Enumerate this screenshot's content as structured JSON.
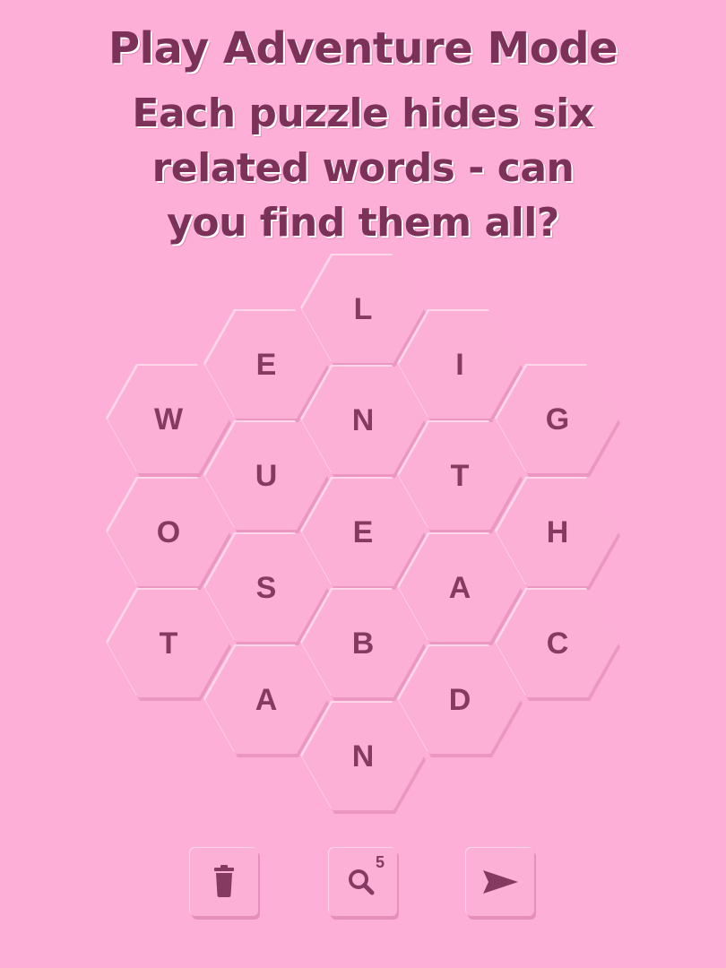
{
  "header": {
    "title": "Play Adventure Mode",
    "subtitle_lines": [
      "Each puzzle hides six",
      "related words - can",
      "you find them all?"
    ]
  },
  "board": {
    "tiles": [
      {
        "letter": "L"
      },
      {
        "letter": "E"
      },
      {
        "letter": "I"
      },
      {
        "letter": "W"
      },
      {
        "letter": "N"
      },
      {
        "letter": "G"
      },
      {
        "letter": "U"
      },
      {
        "letter": "T"
      },
      {
        "letter": "O"
      },
      {
        "letter": "E"
      },
      {
        "letter": "H"
      },
      {
        "letter": "S"
      },
      {
        "letter": "A"
      },
      {
        "letter": "T"
      },
      {
        "letter": "B"
      },
      {
        "letter": "C"
      },
      {
        "letter": "A"
      },
      {
        "letter": "D"
      },
      {
        "letter": "N"
      }
    ]
  },
  "toolbar": {
    "delete_icon": "trash-icon",
    "hint_icon": "magnifier-icon",
    "hint_count": "5",
    "submit_icon": "send-arrow-icon"
  },
  "colors": {
    "background": "#fdafd7",
    "text": "#853a61",
    "tile_shadow": "#eb97c1",
    "tile_highlight": "#ffd6ea"
  }
}
